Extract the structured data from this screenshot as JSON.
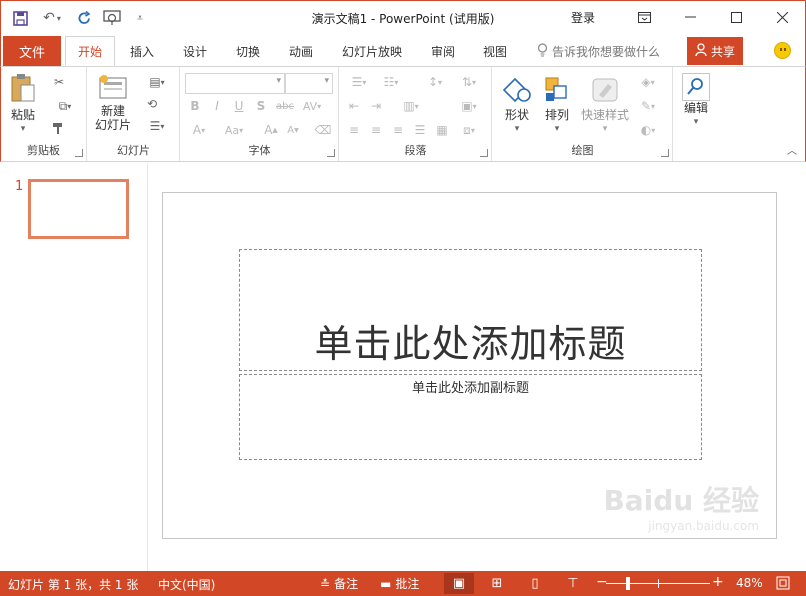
{
  "window": {
    "title": "演示文稿1 - PowerPoint (试用版)",
    "login": "登录",
    "qat": [
      "save-icon",
      "undo-icon",
      "redo-icon",
      "start-from-beginning-icon",
      "customize-qat-icon"
    ],
    "window_buttons": [
      "ribbon-display-options-icon",
      "minimize-icon",
      "maximize-icon",
      "close-icon"
    ]
  },
  "tabs": {
    "file": "文件",
    "items": [
      "开始",
      "插入",
      "设计",
      "切换",
      "动画",
      "幻灯片放映",
      "审阅",
      "视图"
    ],
    "active": "开始",
    "tell_me": "告诉我你想要做什么",
    "share": "共享"
  },
  "ribbon": {
    "clipboard": {
      "label": "剪贴板",
      "paste": "粘贴"
    },
    "slides": {
      "label": "幻灯片",
      "new_slide_line1": "新建",
      "new_slide_line2": "幻灯片"
    },
    "font": {
      "label": "字体",
      "font_name": "",
      "font_size": ""
    },
    "paragraph": {
      "label": "段落"
    },
    "drawing": {
      "label": "绘图",
      "shapes": "形状",
      "arrange": "排列",
      "quick_styles": "快速样式"
    },
    "editing": {
      "label": "编辑"
    }
  },
  "thumbnails": [
    {
      "number": "1"
    }
  ],
  "slide": {
    "title_placeholder": "单击此处添加标题",
    "subtitle_placeholder": "单击此处添加副标题"
  },
  "watermark": {
    "text": "Baidu 经验",
    "sub": "jingyan.baidu.com"
  },
  "status": {
    "slide_info": "幻灯片 第 1 张，共 1 张",
    "language": "中文(中国)",
    "notes": "备注",
    "comments": "批注",
    "zoom_minus": "−",
    "zoom_plus": "+",
    "zoom_percent": "48%",
    "zoom_value": 48
  },
  "colors": {
    "accent": "#d24726",
    "accent_dark": "#a8361c",
    "thumb_border": "#e4825f"
  }
}
